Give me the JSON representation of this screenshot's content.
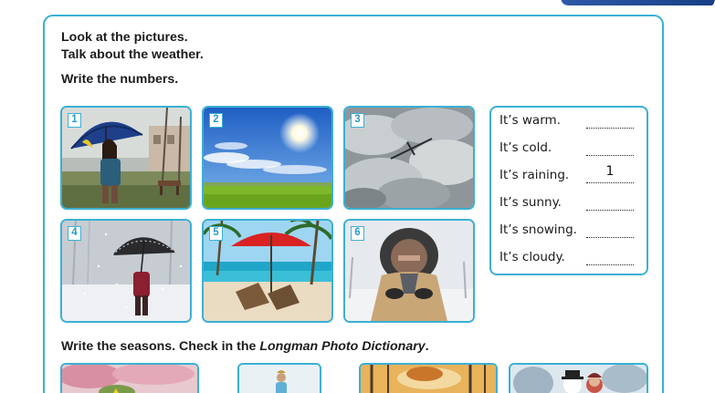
{
  "instructions": {
    "line1": "Look at the pictures.",
    "line2": "Talk about the weather.",
    "line3": "Write the numbers."
  },
  "photos": [
    {
      "number": "1",
      "depicts": "woman-with-umbrella-in-rain"
    },
    {
      "number": "2",
      "depicts": "sunny-sky-over-meadow"
    },
    {
      "number": "3",
      "depicts": "airplane-in-cloudy-sky"
    },
    {
      "number": "4",
      "depicts": "person-with-umbrella-in-snow"
    },
    {
      "number": "5",
      "depicts": "beach-with-red-umbrella"
    },
    {
      "number": "6",
      "depicts": "man-in-fur-hood-in-snow"
    }
  ],
  "answers": [
    {
      "label": "It’s warm.",
      "value": ""
    },
    {
      "label": "It’s cold.",
      "value": ""
    },
    {
      "label": "It’s raining.",
      "value": "1"
    },
    {
      "label": "It’s sunny.",
      "value": ""
    },
    {
      "label": "It’s snowing.",
      "value": ""
    },
    {
      "label": "It’s cloudy.",
      "value": ""
    }
  ],
  "seasons_instruction": {
    "prefix": "Write the seasons. Check in the ",
    "dictionary": "Longman Photo Dictionary",
    "suffix": "."
  },
  "colors": {
    "accent_border": "#3bb0d3",
    "header_tab": "#2d5aa8"
  }
}
